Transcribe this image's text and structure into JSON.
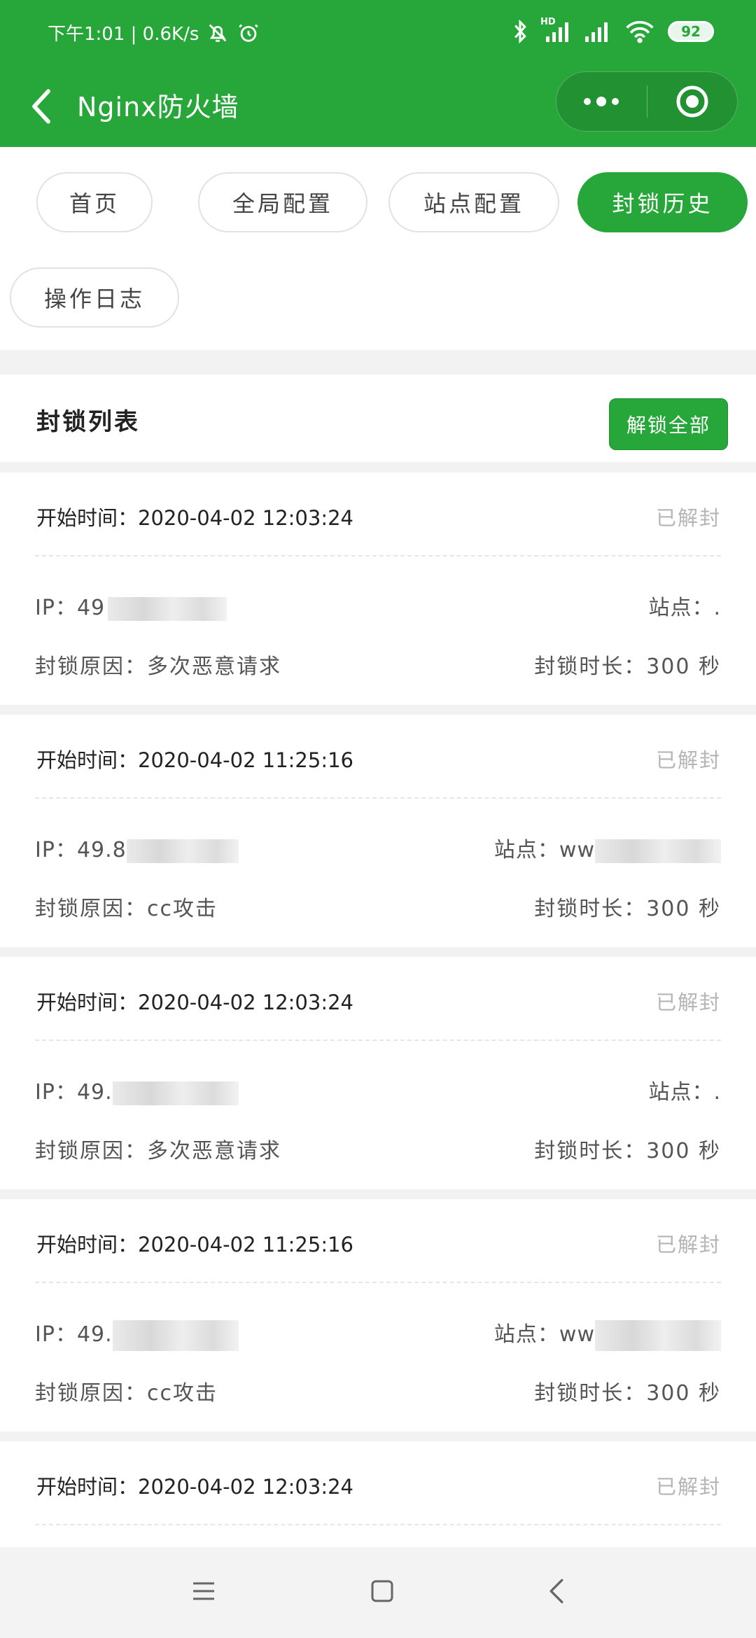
{
  "status_bar": {
    "time_text": "下午1:01 | 0.6K/s",
    "battery": "92",
    "network_badge": "HD"
  },
  "header": {
    "title": "Nginx防火墙"
  },
  "tabs": [
    {
      "label": "首页"
    },
    {
      "label": "全局配置"
    },
    {
      "label": "站点配置"
    },
    {
      "label": "封锁历史"
    },
    {
      "label": "操作日志"
    }
  ],
  "list": {
    "title": "封锁列表",
    "unlock_all_label": "解锁全部",
    "records": [
      {
        "time": "开始时间：2020-04-02 12:03:24",
        "status": "已解封",
        "ip": "IP：49",
        "site": "站点：.",
        "reason": "封锁原因：多次恶意请求",
        "duration": "封锁时长：300 秒"
      },
      {
        "time": "开始时间：2020-04-02 11:25:16",
        "status": "已解封",
        "ip": "IP：49.8",
        "site": "站点：ww",
        "reason": "封锁原因：cc攻击",
        "duration": "封锁时长：300 秒"
      },
      {
        "time": "开始时间：2020-04-02 12:03:24",
        "status": "已解封",
        "ip": "IP：49.",
        "site": "站点：.",
        "reason": "封锁原因：多次恶意请求",
        "duration": "封锁时长：300 秒"
      },
      {
        "time": "开始时间：2020-04-02 11:25:16",
        "status": "已解封",
        "ip": "IP：49.",
        "site": "站点：ww",
        "reason": "封锁原因：cc攻击",
        "duration": "封锁时长：300 秒"
      },
      {
        "time": "开始时间：2020-04-02 12:03:24",
        "status": "已解封"
      }
    ]
  },
  "icons": {
    "back": "chevron-left-icon",
    "more": "more-dots-icon",
    "target": "target-icon",
    "nav_menu": "menu-icon",
    "nav_home": "square-home-icon",
    "nav_back": "back-triangle-icon"
  },
  "colors": {
    "brand": "#27a63a",
    "muted": "#b5b5b5"
  }
}
